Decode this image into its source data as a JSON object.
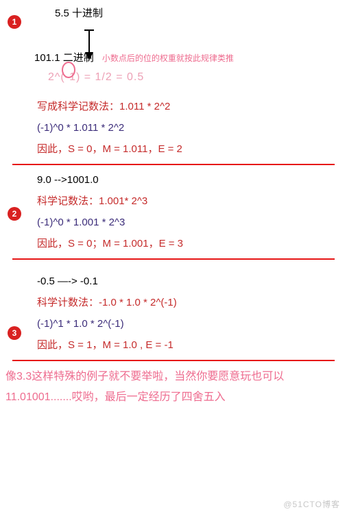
{
  "bullets": {
    "one": "1",
    "two": "2",
    "three": "3"
  },
  "sec1": {
    "decimal": "5.5  十进制",
    "binary_before": "101.",
    "binary_circled": "1",
    "binary_after": " 二进制",
    "anno": "小数点后的位的权重就按此规律类推",
    "eq": "2^(-1)  =  1/2  =  0.5",
    "sci": "写成科学记数法：1.011 * 2^2",
    "neg": "(-1)^0 * 1.011 * 2^2",
    "res": "因此，S = 0，M = 1.011，E = 2"
  },
  "sec2": {
    "conv": "9.0 -->1001.0",
    "sci": "科学记数法：1.001* 2^3",
    "neg": "(-1)^0 * 1.001 * 2^3",
    "res": "因此，S = 0；M = 1.001，E = 3"
  },
  "sec3": {
    "conv": "-0.5 —-> -0.1",
    "sci": "科学计数法：-1.0 * 1.0 * 2^(-1)",
    "neg": "(-1)^1 * 1.0 * 2^(-1)",
    "res": "因此，S = 1，M = 1.0 , E = -1"
  },
  "note": {
    "l1": "像3.3这样特殊的例子就不要举啦，当然你要愿意玩也可以",
    "l2": "11.01001.......哎哟，最后一定经历了四舍五入"
  },
  "watermark": "@51CTO博客"
}
